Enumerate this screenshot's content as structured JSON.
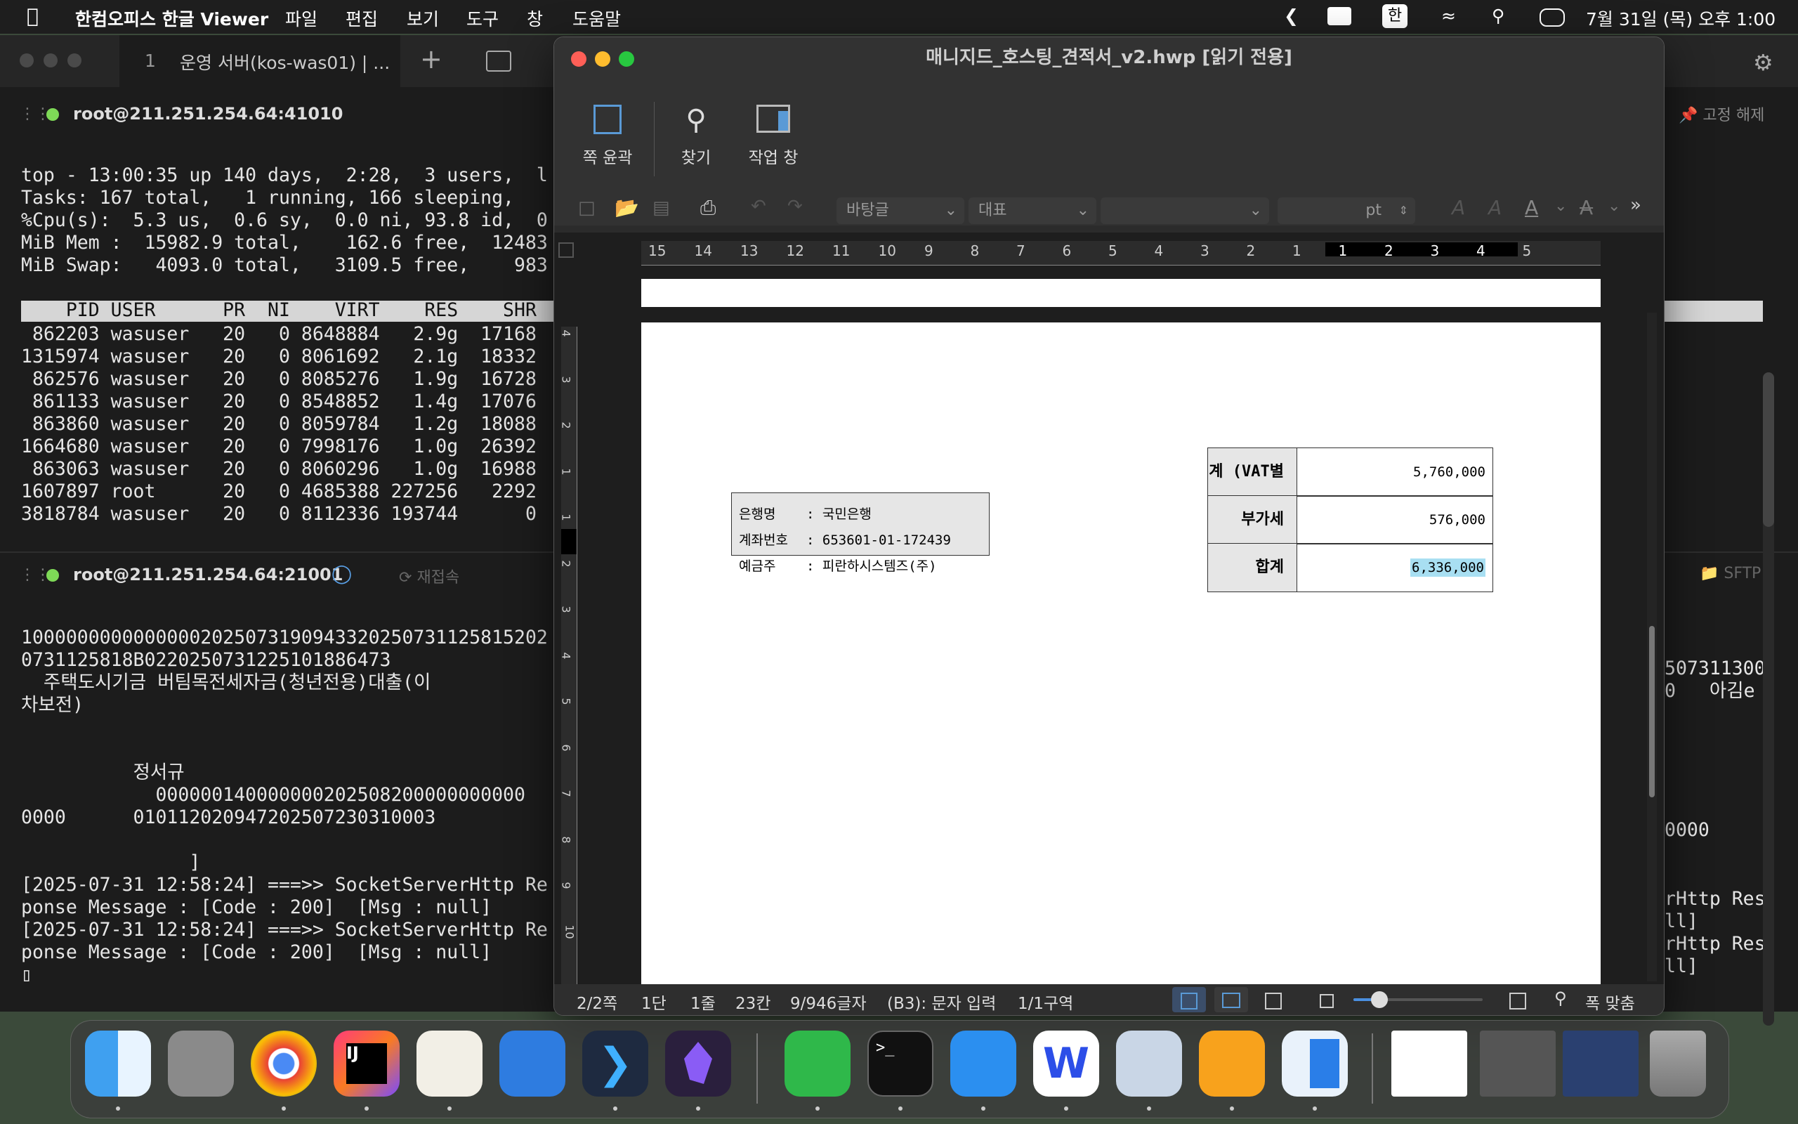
{
  "menubar": {
    "app_name": "한컴오피스 한글 Viewer",
    "menus": [
      "파일",
      "편집",
      "보기",
      "도구",
      "창",
      "도움말"
    ],
    "input_source": "한",
    "clock": "7월 31일 (목) 오후 1:00"
  },
  "terminal": {
    "tab_number": "1",
    "tab_title": "운영 서버(kos-was01) | ...",
    "pin_label": "고정 해제",
    "session1_host": "root@211.251.254.64:41010",
    "session1_lines": [
      "top - 13:00:35 up 140 days,  2:28,  3 users,  l",
      "Tasks: 167 total,   1 running, 166 sleeping,   ",
      "%Cpu(s):  5.3 us,  0.6 sy,  0.0 ni, 93.8 id,  0",
      "MiB Mem :  15982.9 total,    162.6 free,  12483",
      "MiB Swap:   4093.0 total,   3109.5 free,    983"
    ],
    "process_header": "    PID USER      PR  NI    VIRT    RES    SHR ",
    "process_rows": [
      " 862203 wasuser   20   0 8648884   2.9g  17168 ",
      "1315974 wasuser   20   0 8061692   2.1g  18332 ",
      " 862576 wasuser   20   0 8085276   1.9g  16728 ",
      " 861133 wasuser   20   0 8548852   1.4g  17076 ",
      " 863860 wasuser   20   0 8059784   1.2g  18088 ",
      "1664680 wasuser   20   0 7998176   1.0g  26392 ",
      " 863063 wasuser   20   0 8060296   1.0g  16988 ",
      "1607897 root      20   0 4685388 227256   2292 ",
      "3818784 wasuser   20   0 8112336 193744      0 "
    ],
    "session2_host": "root@211.251.254.64:21001",
    "reconnect_label": "재접속",
    "sftp_label": "SFTP",
    "session2_lines": [
      "1000000000000000202507319094332025073112581520​2",
      "0731125818B02202507312251018864​73",
      "  주택도시기금 버팀목전세자금(청년전용)대출(이",
      "차보전)",
      "",
      "",
      "          정서규",
      "            000000140000000202508200000000000",
      "0000      0101120209472025072303100​03",
      "",
      "               ]",
      "[2025-07-31 12:58:24] ===>> SocketServerHttp Re",
      "ponse Message : [Code : 200]  [Msg : null]",
      "[2025-07-31 12:58:24] ===>> SocketServerHttp Re",
      "ponse Message : [Code : 200]  [Msg : null]",
      "▯"
    ],
    "right_fragments": [
      "507311300",
      "0   아김e",
      "0000",
      "rHttp Res",
      "ll]",
      "rHttp Res",
      "ll]"
    ]
  },
  "hwp": {
    "title": "매니지드_호스팅_견적서_v2.hwp [읽기 전용]",
    "toolbar": {
      "page_outline": "쪽 윤곽",
      "find": "찾기",
      "task_pane": "작업 창"
    },
    "font_combo": "바탕글",
    "style_combo": "대표",
    "size_unit": "pt",
    "ruler_labels": [
      "15",
      "14",
      "13",
      "12",
      "11",
      "10",
      "9",
      "8",
      "7",
      "6",
      "5",
      "4",
      "3",
      "2",
      "1",
      "1",
      "2",
      "3",
      "4",
      "5"
    ],
    "vruler_labels": [
      "4",
      "3",
      "2",
      "1",
      "1",
      "2",
      "3",
      "4",
      "5",
      "6",
      "7",
      "8",
      "9",
      "10"
    ],
    "bank_box": {
      "rows": [
        {
          "label": "은행명",
          "value": ": 국민은행"
        },
        {
          "label": "계좌번호",
          "value": ": 653601-01-172439"
        },
        {
          "label": "예금주",
          "value": ": 피란하시스템즈(주)"
        }
      ]
    },
    "totals": [
      {
        "label": "계 (VAT별도)",
        "value": "5,760,000"
      },
      {
        "label": "부가세",
        "value": "576,000"
      },
      {
        "label": "합계",
        "value": "6,336,000"
      }
    ],
    "status": {
      "page": "2/2쪽",
      "column": "1단",
      "line": "1줄",
      "col": "23칸",
      "chars": "9/946글자",
      "mode": "(B3): 문자 입력",
      "section": "1/1구역",
      "zoom_fit": "폭 맞춤",
      "zoom_level": 0.2
    }
  },
  "dock": {
    "apps": [
      "finder-icon",
      "launchpad-icon",
      "chrome-icon",
      "intellij-icon",
      "dbeaver-icon",
      "file-manager-icon",
      "vscode-icon",
      "obsidian-icon",
      "numbers-icon",
      "terminal-icon",
      "keynote-icon",
      "naver-whale-icon",
      "preview-icon",
      "pages-icon",
      "hwp-icon",
      "window-thumb-1",
      "window-thumb-2",
      "window-thumb-3",
      "trash-icon"
    ]
  }
}
